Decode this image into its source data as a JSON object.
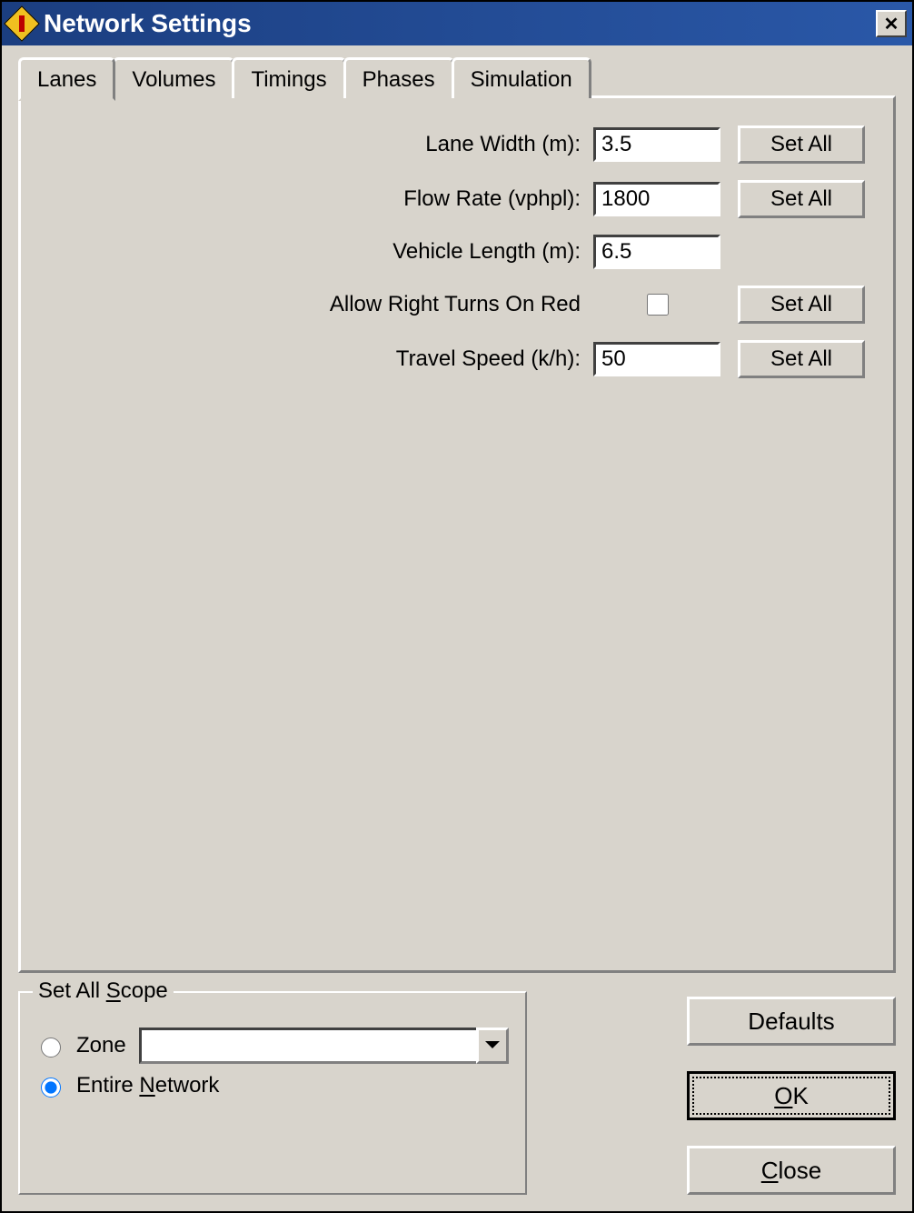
{
  "window": {
    "title": "Network Settings"
  },
  "tabs": [
    {
      "label": "Lanes",
      "active": true
    },
    {
      "label": "Volumes"
    },
    {
      "label": "Timings"
    },
    {
      "label": "Phases"
    },
    {
      "label": "Simulation"
    }
  ],
  "lanes_form": {
    "rows": [
      {
        "label": "Lane Width (m):",
        "value": "3.5",
        "setall": "Set All",
        "has_setall": true,
        "is_checkbox": false
      },
      {
        "label": "Flow Rate (vphpl):",
        "value": "1800",
        "setall": "Set All",
        "has_setall": true,
        "is_checkbox": false
      },
      {
        "label": "Vehicle Length (m):",
        "value": "6.5",
        "setall": "",
        "has_setall": false,
        "is_checkbox": false
      },
      {
        "label": "Allow Right Turns On Red",
        "value": "",
        "setall": "Set All",
        "has_setall": true,
        "is_checkbox": true,
        "checked": false
      },
      {
        "label": "Travel Speed (k/h):",
        "value": "50",
        "setall": "Set All",
        "has_setall": true,
        "is_checkbox": false
      }
    ]
  },
  "scope": {
    "legend_prefix": "Set All ",
    "legend_accel": "S",
    "legend_suffix": "cope",
    "zone_label": "Zone",
    "network_prefix": "Entire ",
    "network_accel": "N",
    "network_suffix": "etwork",
    "selected": "network",
    "zone_value": ""
  },
  "buttons": {
    "defaults": "Defaults",
    "ok_accel": "O",
    "ok_suffix": "K",
    "close_accel": "C",
    "close_suffix": "lose"
  }
}
